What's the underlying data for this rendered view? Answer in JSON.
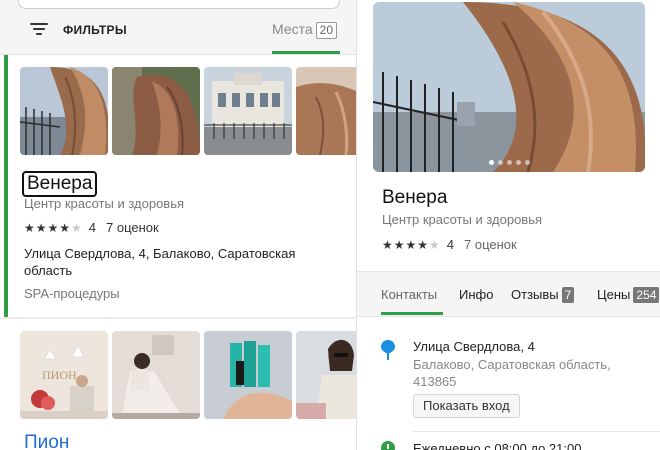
{
  "filters": {
    "label": "ФИЛЬТРЫ",
    "icon": "filter-icon"
  },
  "places_tab": {
    "label": "Места",
    "count": "20"
  },
  "results": [
    {
      "name": "Венера",
      "category": "Центр красоты и здоровья",
      "rating": "4",
      "stars_filled": 4,
      "reviews": "7 оценок",
      "address": "Улица Свердлова, 4, Балаково, Саратовская область",
      "service": "SPA-процедуры"
    },
    {
      "name": "Пион",
      "photo_text": "ПИОН"
    }
  ],
  "detail": {
    "name": "Венера",
    "category": "Центр красоты и здоровья",
    "rating": "4",
    "stars_filled": 4,
    "reviews": "7 оценок",
    "photo_count": 5,
    "tabs": [
      {
        "label": "Контакты"
      },
      {
        "label": "Инфо"
      },
      {
        "label": "Отзывы",
        "badge": "7"
      },
      {
        "label": "Цены",
        "badge": "254"
      }
    ],
    "address_main": "Улица Свердлова, 4",
    "address_sub": "Балаково, Саратовская область, 413865",
    "entrance_button": "Показать вход",
    "hours": "Ежедневно с 08:00 до 21:00"
  },
  "colors": {
    "accent": "#2e9f46",
    "link": "#1e6fd0",
    "pin": "#1a8fe0"
  }
}
